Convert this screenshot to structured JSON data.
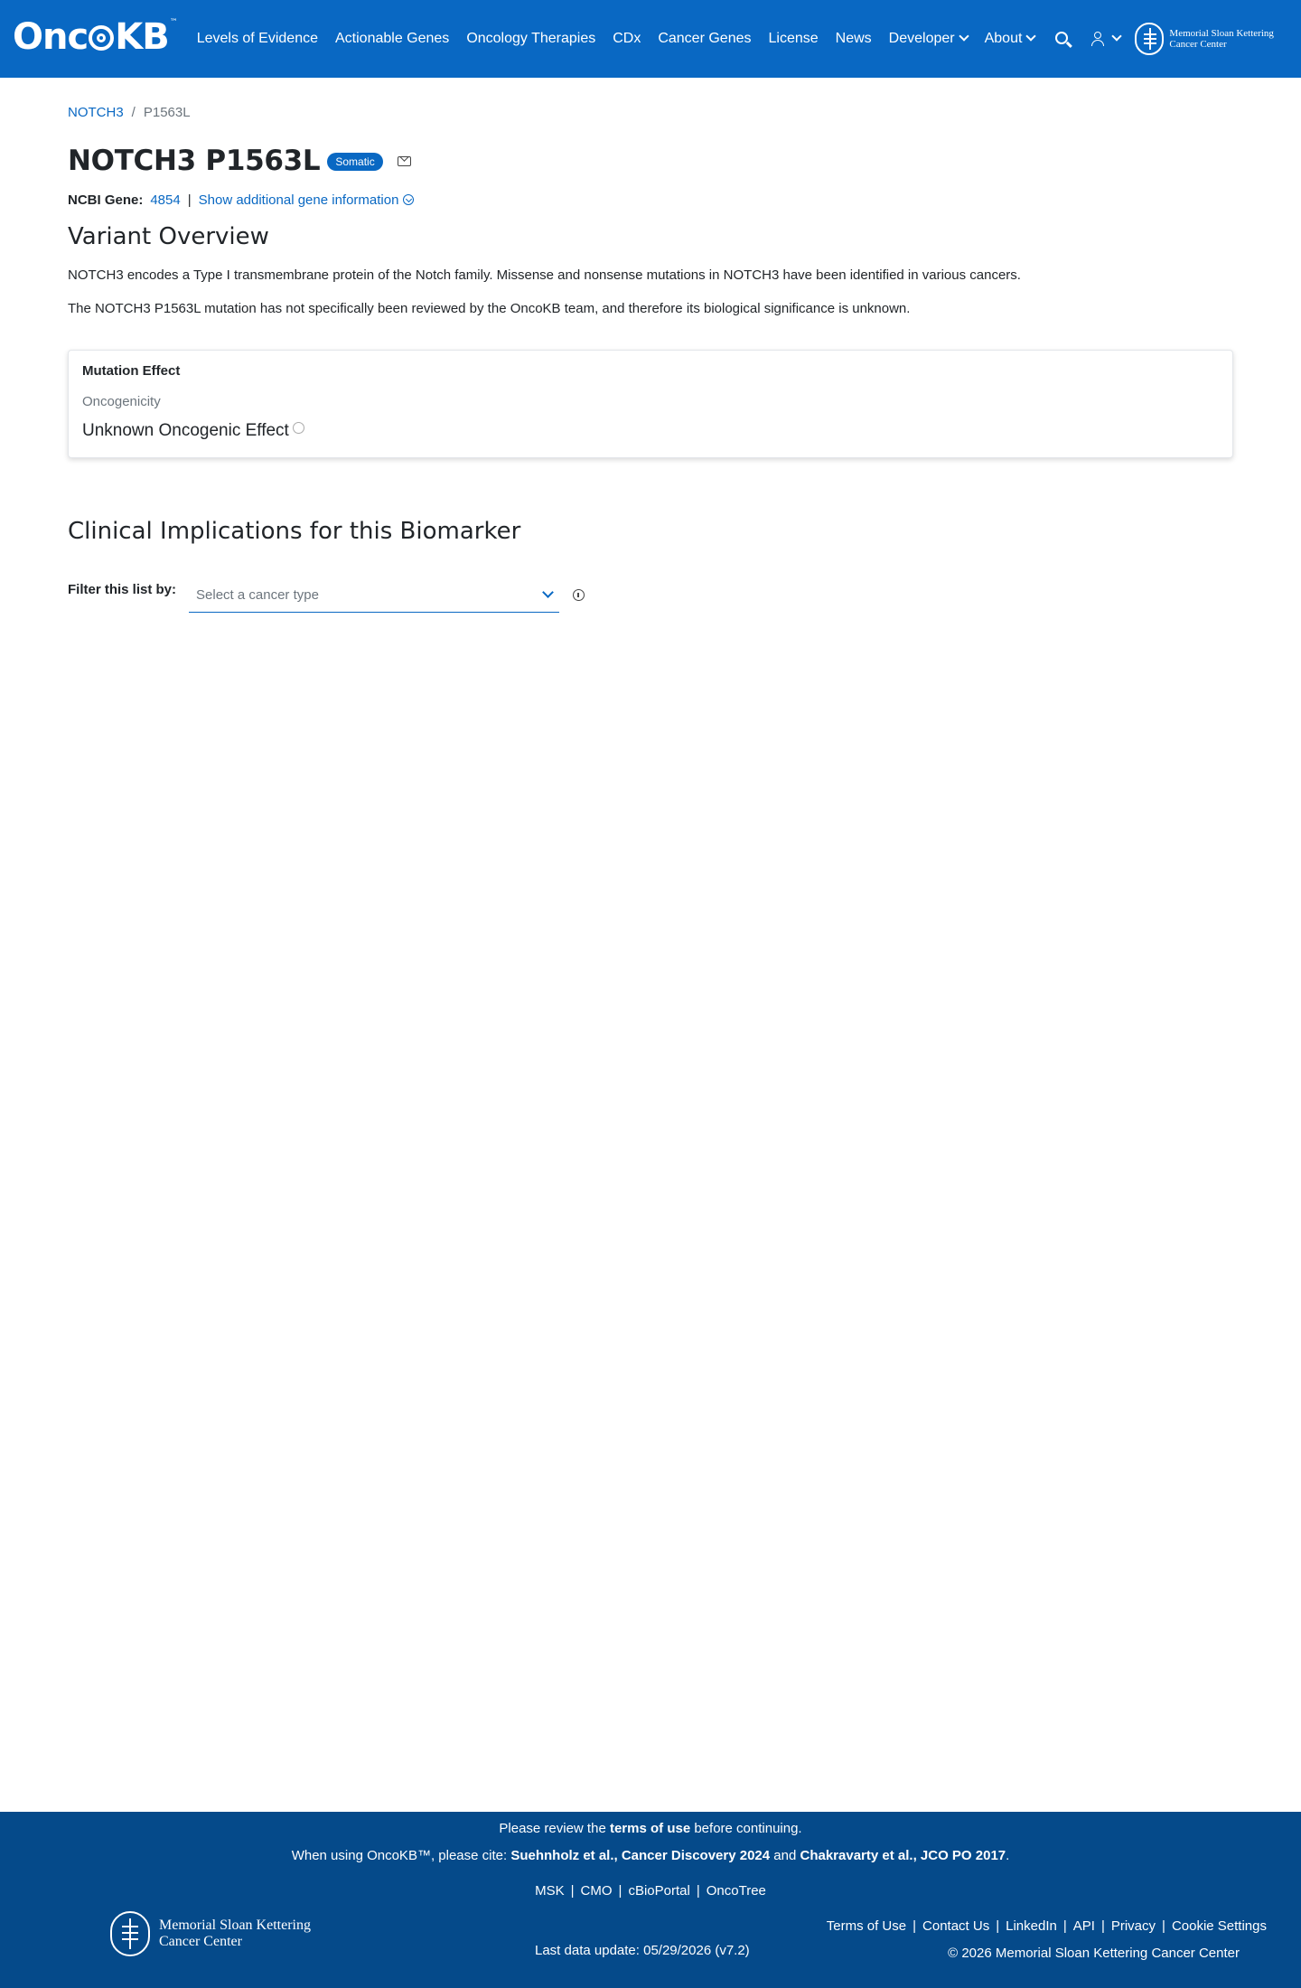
{
  "nav": {
    "logo_text_a": "Onc",
    "logo_text_b": "KB",
    "logo_tm": "™",
    "items": [
      {
        "label": "Levels of Evidence"
      },
      {
        "label": "Actionable Genes"
      },
      {
        "label": "Oncology Therapies"
      },
      {
        "label": "CDx"
      },
      {
        "label": "Cancer Genes"
      },
      {
        "label": "License"
      },
      {
        "label": "News"
      },
      {
        "label": "Developer"
      },
      {
        "label": "About"
      }
    ],
    "msk_line1": "Memorial Sloan Kettering",
    "msk_line2": "Cancer Center"
  },
  "breadcrumb": {
    "gene": "NOTCH3",
    "separator": "/",
    "variant": "P1563L"
  },
  "header": {
    "title": "NOTCH3 P1563L",
    "badge": "Somatic"
  },
  "gene_info": {
    "label": "NCBI Gene:",
    "ncbi_id": "4854",
    "separator": "|",
    "show_more": "Show additional gene information"
  },
  "overview": {
    "title": "Variant Overview",
    "paragraph1": "NOTCH3 encodes a Type I transmembrane protein of the Notch family. Missense and nonsense mutations in NOTCH3 have been identified in various cancers.",
    "paragraph2": "The NOTCH3 P1563L mutation has not specifically been reviewed by the OncoKB team, and therefore its biological significance is unknown."
  },
  "mutation_effect": {
    "title": "Mutation Effect",
    "subtitle": "Oncogenicity",
    "value": "Unknown Oncogenic Effect"
  },
  "clinical": {
    "title": "Clinical Implications for this Biomarker",
    "filter_label": "Filter this list by:",
    "select_placeholder": "Select a cancer type"
  },
  "footer": {
    "review_pre": "Please review the ",
    "review_link": "terms of use",
    "review_post": " before continuing.",
    "cite_pre": "When using OncoKB™, please cite: ",
    "cite_1": "Suehnholz et al., Cancer Discovery 2024",
    "cite_and": " and ",
    "cite_2": "Chakravarty et al., JCO PO 2017",
    "cite_end": ".",
    "links": [
      "MSK",
      "CMO",
      "cBioPortal",
      "OncoTree"
    ],
    "right_links": [
      "Terms of Use",
      "Contact Us",
      "LinkedIn",
      "API",
      "Privacy",
      "Cookie Settings"
    ],
    "separator": "|",
    "last_update": "Last data update: 05/29/2026 (v7.2)",
    "copyright": "© 2026 Memorial Sloan Kettering Cancer Center",
    "msk_line1": "Memorial Sloan Kettering",
    "msk_line2": "Cancer Center"
  },
  "colors": {
    "brand": "#0968c3",
    "footer": "#054a8a"
  }
}
